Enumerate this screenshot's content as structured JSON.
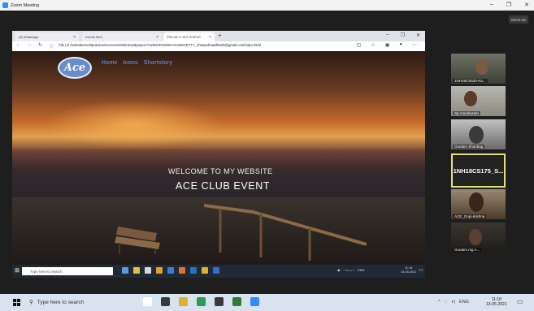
{
  "zoom": {
    "title": "Zoom Meeting",
    "timer": "00:01:32",
    "controls": [
      "–",
      "❐",
      "✕"
    ]
  },
  "browser": {
    "tabs": [
      {
        "label": "(8) WhatsApp",
        "close": "×"
      },
      {
        "label": "events.html",
        "close": "×"
      },
      {
        "label": "PROJECT ACE EVENT",
        "close": "×"
      }
    ],
    "new_tab": "+",
    "controls": [
      "–",
      "❐",
      "✕"
    ],
    "url": "File | E:/websites%20practice/verzeo%20mini%20project-%20SHRADDHA%20SHETTY_shettyshraddha00@gmail.com/index.html"
  },
  "site": {
    "logo": "Ace",
    "nav": [
      "Home",
      "Icons",
      "Shortstory"
    ],
    "welcome": "WELCOME TO MY WEBSITE",
    "headline": "ACE CLUB EVENT"
  },
  "inner_taskbar": {
    "search_placeholder": "Type here to search",
    "tray": "ENG",
    "time": "11:18",
    "date": "13-05-2021",
    "icon_colors": [
      "#5a9be0",
      "#e0c040",
      "#d8d8d8",
      "#e0a030",
      "#3a80d0",
      "#e07030",
      "#2a70c0",
      "#e0b030",
      "#2e6fd0"
    ]
  },
  "participants": [
    {
      "name": "1NH18CS520-Ka..."
    },
    {
      "name": "Sp AnushaHan"
    },
    {
      "name": "Goutam Shanbag"
    },
    {
      "name": "1NH18CS175_S..."
    },
    {
      "name": "ACE_Gopi-krishna"
    },
    {
      "name": "Goutam.mg A..."
    }
  ],
  "taskbar": {
    "search_placeholder": "Type here to search",
    "tray": "ENG",
    "time": "11:18",
    "date": "13-05-2021",
    "icon_colors": [
      "#ffffff",
      "#3a3a3a",
      "#e0b030",
      "#2a9d50",
      "#3a3a3a",
      "#2e7d32",
      "#2d8cff"
    ]
  }
}
